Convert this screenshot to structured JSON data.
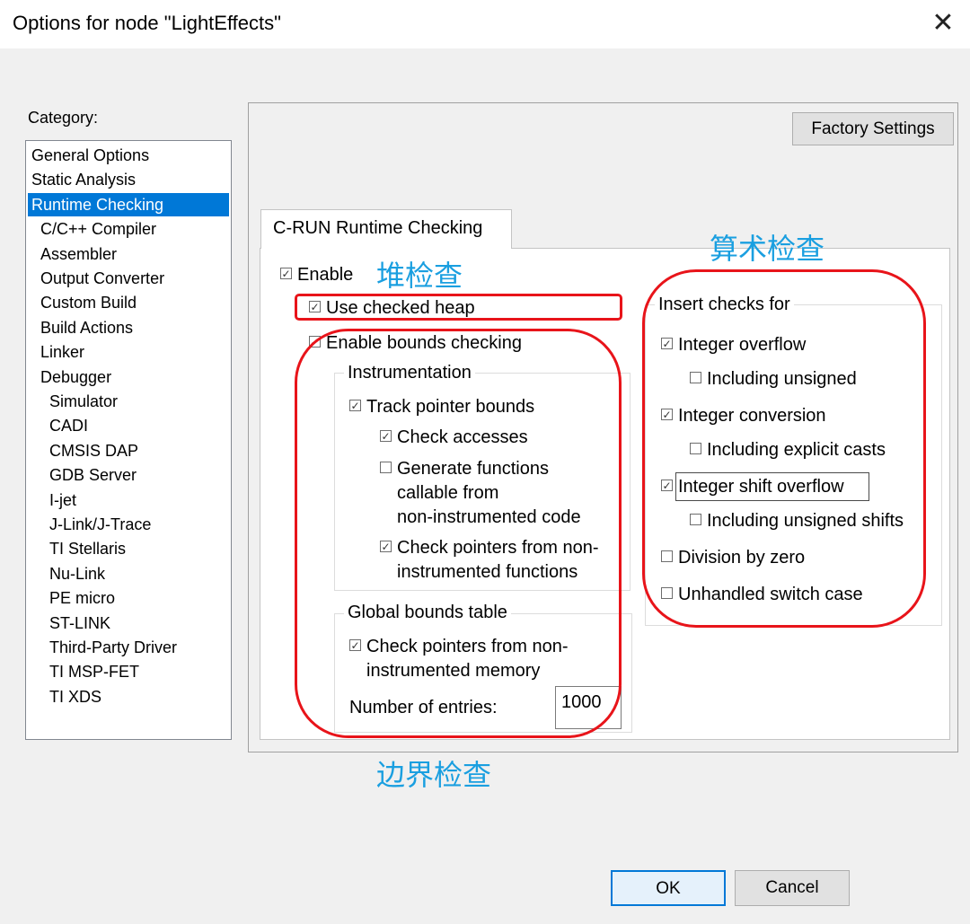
{
  "window": {
    "title": "Options for node \"LightEffects\"",
    "close_glyph": "✕"
  },
  "category": {
    "label": "Category:",
    "items": [
      "General Options",
      "Static Analysis",
      "Runtime Checking",
      "C/C++ Compiler",
      "Assembler",
      "Output Converter",
      "Custom Build",
      "Build Actions",
      "Linker",
      "Debugger",
      "Simulator",
      "CADI",
      "CMSIS DAP",
      "GDB Server",
      "I-jet",
      "J-Link/J-Trace",
      "TI Stellaris",
      "Nu-Link",
      "PE micro",
      "ST-LINK",
      "Third-Party Driver",
      "TI MSP-FET",
      "TI XDS"
    ],
    "selected": "Runtime Checking"
  },
  "factory_settings_label": "Factory Settings",
  "tab": {
    "label": "C-RUN Runtime Checking"
  },
  "options": {
    "enable": {
      "label": "Enable",
      "checked": true
    },
    "use_checked_heap": {
      "label": "Use checked heap",
      "checked": true
    },
    "enable_bounds": {
      "label": "Enable bounds checking",
      "checked": true
    },
    "instrumentation": {
      "title": "Instrumentation",
      "track_pointer_bounds": {
        "label": "Track pointer bounds",
        "checked": true
      },
      "check_accesses": {
        "label": "Check accesses",
        "checked": true
      },
      "generate_functions": {
        "lines": [
          "Generate functions",
          "callable from",
          "non-instrumented code"
        ],
        "checked": false
      },
      "check_pointers_functions": {
        "lines": [
          "Check pointers from non-",
          "instrumented functions"
        ],
        "checked": true
      }
    },
    "global_bounds": {
      "title": "Global bounds table",
      "check_pointers_memory": {
        "lines": [
          "Check pointers from non-",
          "instrumented memory"
        ],
        "checked": true
      },
      "entries_label": "Number of entries:",
      "entries_value": "1000"
    },
    "insert_checks": {
      "title": "Insert checks for",
      "integer_overflow": {
        "label": "Integer overflow",
        "checked": true
      },
      "including_unsigned": {
        "label": "Including unsigned",
        "checked": false
      },
      "integer_conversion": {
        "label": "Integer conversion",
        "checked": true
      },
      "including_explicit_casts": {
        "label": "Including explicit casts",
        "checked": false
      },
      "integer_shift_overflow": {
        "label": "Integer shift overflow",
        "checked": true
      },
      "including_unsigned_shifts": {
        "label": "Including unsigned shifts",
        "checked": false
      },
      "division_by_zero": {
        "label": "Division by zero",
        "checked": false
      },
      "unhandled_switch": {
        "label": "Unhandled switch case",
        "checked": false
      }
    }
  },
  "annotations": {
    "heap_check": "堆检查",
    "arithmetic_check": "算术检查",
    "bounds_check": "边界检查",
    "color": "#1a9fe0",
    "ring_color": "#e8141a"
  },
  "buttons": {
    "ok": "OK",
    "cancel": "Cancel"
  }
}
